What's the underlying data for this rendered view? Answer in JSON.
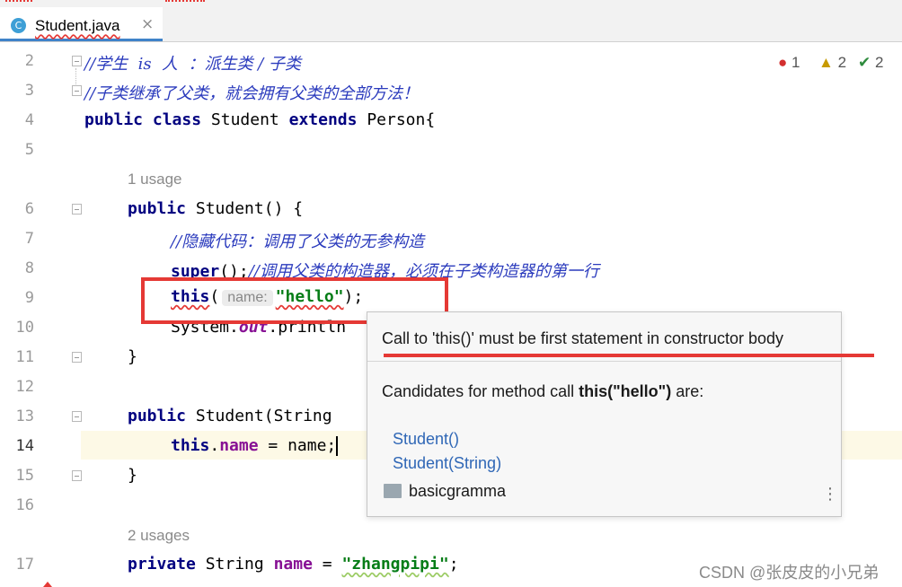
{
  "tab": {
    "icon_letter": "C",
    "label": "Student.java",
    "close": "×"
  },
  "inspections": {
    "errors": "1",
    "warnings": "2",
    "ok": "2"
  },
  "line_numbers": [
    "2",
    "3",
    "4",
    "5",
    "6",
    "7",
    "8",
    "9",
    "10",
    "11",
    "12",
    "13",
    "14",
    "15",
    "16",
    "17"
  ],
  "code": {
    "l2_comment": "//学生  is  人  ：派生类 / 子类",
    "l3_comment": "//子类继承了父类，就会拥有父类的全部方法！",
    "l4_kw1": "public",
    "l4_kw2": "class",
    "l4_name": "Student",
    "l4_kw3": "extends",
    "l4_super": "Person{",
    "usage1": "1 usage",
    "l6_kw": "public",
    "l6_rest": "Student() {",
    "l7_comment": "//隐藏代码：调用了父类的无参构造",
    "l8_kw": "super",
    "l8_paren": "();",
    "l8_comment": "//调用父类的构造器，必须在子类构造器的第一行",
    "l9_kw": "this",
    "l9_open": "(",
    "l9_hint": "name:",
    "l9_str": "\"hello\"",
    "l9_close": ");",
    "l10_text": "System.",
    "l10_out": "out",
    "l10_rest": ".println",
    "l11_brace": "}",
    "l13_kw": "public",
    "l13_rest": "Student(String",
    "l14_kw": "this",
    "l14_dot": ".",
    "l14_field": "name",
    "l14_rest": " = name;",
    "l15_brace": "}",
    "usage2": "2 usages",
    "l17_kw": "private",
    "l17_type": "String",
    "l17_field": "name",
    "l17_eq": "=",
    "l17_str": "\"zhangpipi\"",
    "l17_semi": ";"
  },
  "popup": {
    "title": "Call to 'this()' must be first statement in constructor body",
    "candidates_prefix": "Candidates for method call ",
    "candidates_bold": "this(\"hello\")",
    "candidates_suffix": " are:",
    "candidate_1": "Student()",
    "candidate_2": "Student(String)",
    "package": "basicgramma",
    "menu_icon": "⋮"
  },
  "watermark": "CSDN @张皮皮的小兄弟",
  "colors": {
    "error_red": "#e53935",
    "comment_blue": "#2b3bbd",
    "keyword_navy": "#000080",
    "string_green": "#067d17",
    "field_purple": "#871094",
    "link_blue": "#2f67b6"
  }
}
